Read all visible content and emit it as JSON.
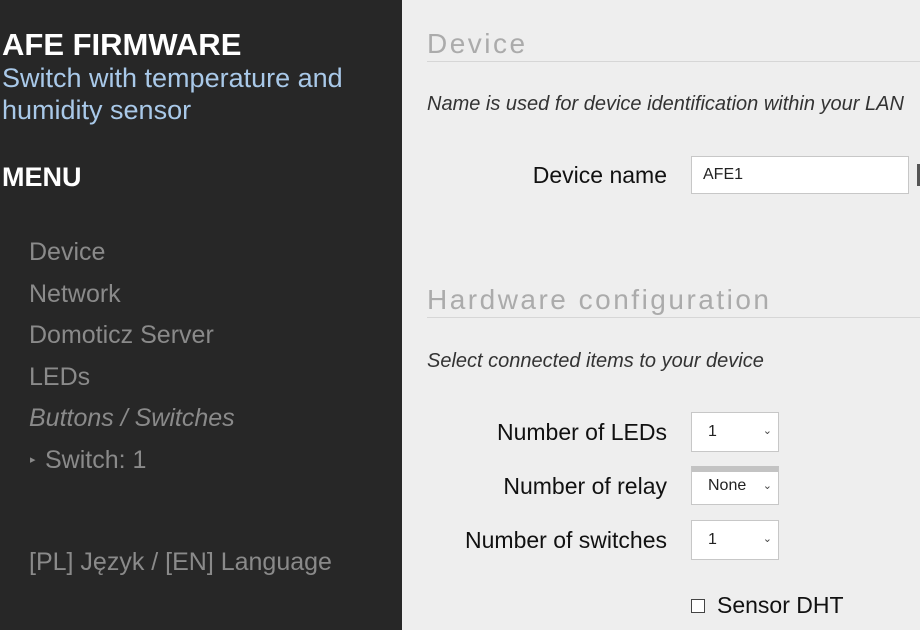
{
  "sidebar": {
    "title": "AFE FIRMWARE",
    "subtitle": "Switch with temperature and humidity sensor",
    "menu_heading": "MENU",
    "items": [
      {
        "label": "Device"
      },
      {
        "label": "Network"
      },
      {
        "label": "Domoticz Server"
      },
      {
        "label": "LEDs"
      },
      {
        "label": "Buttons / Switches"
      },
      {
        "label": "Switch: 1",
        "bullet": "▸"
      }
    ],
    "language_link": "[PL] Język / [EN] Language"
  },
  "device_section": {
    "title": "Device",
    "description": "Name is used for device identification within your LAN",
    "device_name_label": "Device name",
    "device_name_value": "AFE1"
  },
  "hardware_section": {
    "title": "Hardware configuration",
    "description": "Select connected items to your device",
    "leds_label": "Number of LEDs",
    "leds_value": "1",
    "relay_label": "Number of relay",
    "relay_value": "None",
    "switches_label": "Number of switches",
    "switches_value": "1",
    "sensor_dht_label": "Sensor DHT",
    "sensor_dht_checked": false
  },
  "icons": {
    "select_chevron": "chevron-down-icon",
    "checkbox": "checkbox-icon",
    "submenu_bullet": "triangle-right-icon"
  },
  "colors": {
    "sidebar_bg": "#272727",
    "main_bg": "#eeeeee",
    "subtitle": "#a9c9e9",
    "menu_item": "#8a8a8a",
    "section_title": "#ababab"
  }
}
